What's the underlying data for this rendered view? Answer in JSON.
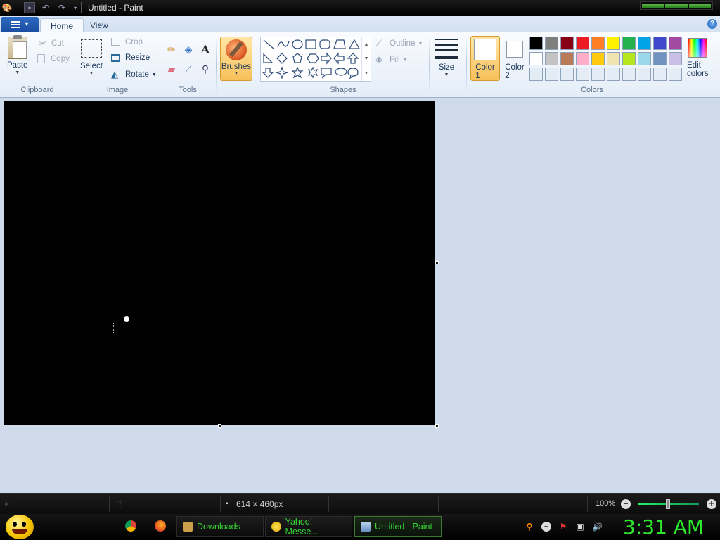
{
  "window": {
    "title": "Untitled - Paint"
  },
  "tabs": [
    {
      "label": "Home"
    },
    {
      "label": "View"
    }
  ],
  "clipboard": {
    "group_label": "Clipboard",
    "paste": "Paste",
    "cut": "Cut",
    "copy": "Copy"
  },
  "image": {
    "group_label": "Image",
    "select": "Select",
    "crop": "Crop",
    "resize": "Resize",
    "rotate": "Rotate"
  },
  "tools": {
    "group_label": "Tools"
  },
  "brushes": {
    "label": "Brushes"
  },
  "shapes": {
    "group_label": "Shapes",
    "outline": "Outline",
    "fill": "Fill"
  },
  "size": {
    "label": "Size"
  },
  "colors": {
    "group_label": "Colors",
    "color1": {
      "label": "Color\n1",
      "value": "#ffffff"
    },
    "color2": {
      "label": "Color\n2",
      "value": "#ffffff"
    },
    "edit_colors": "Edit colors",
    "palette_row1": [
      "#000000",
      "#7f7f7f",
      "#880015",
      "#ed1c24",
      "#ff7f27",
      "#fff200",
      "#22b14c",
      "#00a2e8",
      "#3f48cc",
      "#a349a4"
    ],
    "palette_row2": [
      "#ffffff",
      "#c3c3c3",
      "#b97a57",
      "#ffaec9",
      "#ffc90e",
      "#efe4b0",
      "#b5e61d",
      "#99d9ea",
      "#7092be",
      "#c8bfe7"
    ],
    "palette_row3": [
      "#e4ecf6",
      "#e4ecf6",
      "#e4ecf6",
      "#e4ecf6",
      "#e4ecf6",
      "#e4ecf6",
      "#e4ecf6",
      "#e4ecf6",
      "#e4ecf6",
      "#e4ecf6"
    ]
  },
  "canvas": {
    "background": "#000000"
  },
  "status": {
    "dimensions": "614 × 460px",
    "zoom": "100%"
  },
  "taskbar": {
    "tasks": [
      {
        "label": "Downloads"
      },
      {
        "label": "Yahoo! Messe..."
      },
      {
        "label": "Untitled - Paint"
      }
    ],
    "clock": "3:31 AM"
  }
}
